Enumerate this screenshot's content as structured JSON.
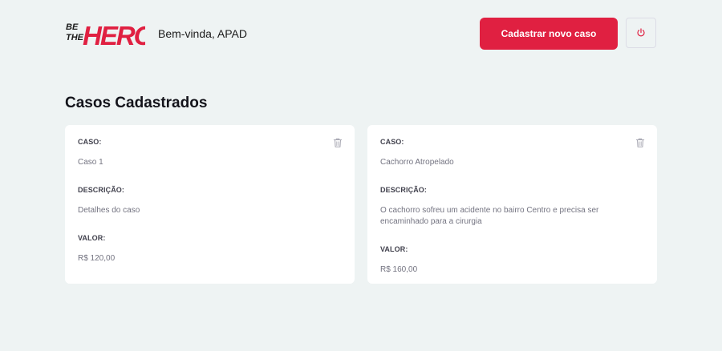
{
  "header": {
    "logo_top": "BE",
    "logo_mid": "THE",
    "logo_main": "HERO",
    "welcome": "Bem-vinda, APAD",
    "new_case_label": "Cadastrar novo caso",
    "logout_icon": "power-icon"
  },
  "main": {
    "title": "Casos Cadastrados",
    "cases": [
      {
        "caso_label": "CASO:",
        "caso_value": "Caso 1",
        "descricao_label": "DESCRIÇÃO:",
        "descricao_value": "Detalhes do caso",
        "valor_label": "VALOR:",
        "valor_value": "R$ 120,00"
      },
      {
        "caso_label": "CASO:",
        "caso_value": "Cachorro Atropelado",
        "descricao_label": "DESCRIÇÃO:",
        "descricao_value": "O cachorro sofreu um acidente no bairro Centro e precisa ser encaminhado para a cirurgia",
        "valor_label": "VALOR:",
        "valor_value": "R$ 160,00"
      }
    ]
  },
  "colors": {
    "brand": "#e02041",
    "background": "#eef3f3",
    "card": "#ffffff"
  }
}
